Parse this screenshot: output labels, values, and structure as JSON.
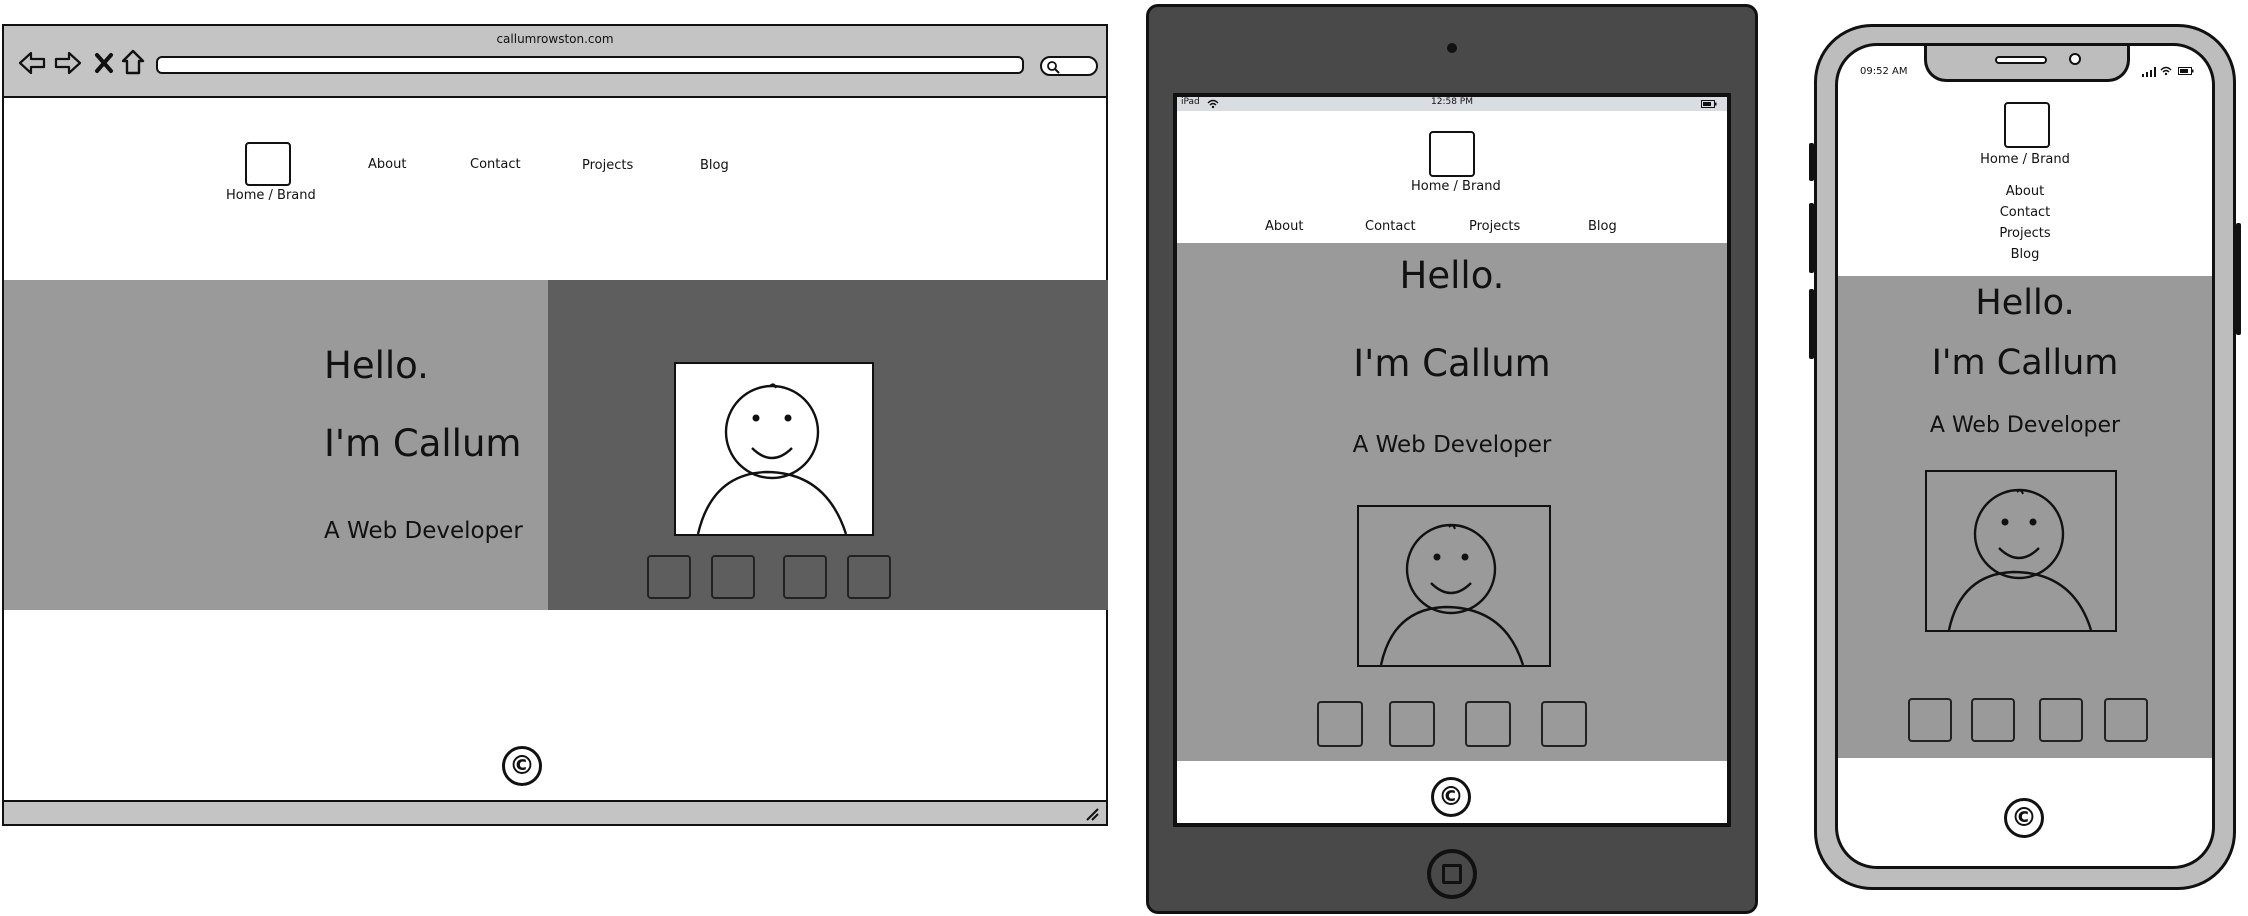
{
  "browser": {
    "url": "callumrowston.com",
    "nav": {
      "brand": "Home / Brand",
      "items": [
        "About",
        "Contact",
        "Projects",
        "Blog"
      ]
    },
    "hero": {
      "greeting": "Hello.",
      "name": "I'm Callum",
      "role": "A Web Developer"
    },
    "footer": {
      "symbol": "©"
    }
  },
  "tablet": {
    "status": {
      "device": "iPad",
      "time": "12:58 PM"
    },
    "nav": {
      "brand": "Home / Brand",
      "items": [
        "About",
        "Contact",
        "Projects",
        "Blog"
      ]
    },
    "hero": {
      "greeting": "Hello.",
      "name": "I'm Callum",
      "role": "A Web Developer"
    },
    "footer": {
      "symbol": "©"
    }
  },
  "phone": {
    "status": {
      "time": "09:52 AM"
    },
    "nav": {
      "brand": "Home / Brand",
      "items": [
        "About",
        "Contact",
        "Projects",
        "Blog"
      ]
    },
    "hero": {
      "greeting": "Hello.",
      "name": "I'm Callum",
      "role": "A Web Developer"
    },
    "footer": {
      "symbol": "©"
    }
  },
  "icons": {
    "back": "back-arrow-icon",
    "forward": "forward-arrow-icon",
    "close": "close-icon",
    "home": "home-icon",
    "search": "search-icon",
    "resize": "resize-grip-icon",
    "avatar": "avatar-placeholder-icon",
    "copyright": "copyright-icon",
    "wifi": "wifi-icon",
    "battery": "battery-icon",
    "signal": "signal-icon"
  },
  "colors": {
    "hero_light": "#9a9a9a",
    "hero_dark": "#5e5e5e",
    "chrome": "#c4c4c4",
    "tablet_body": "#494949",
    "phone_frame": "#bdbdbd"
  }
}
